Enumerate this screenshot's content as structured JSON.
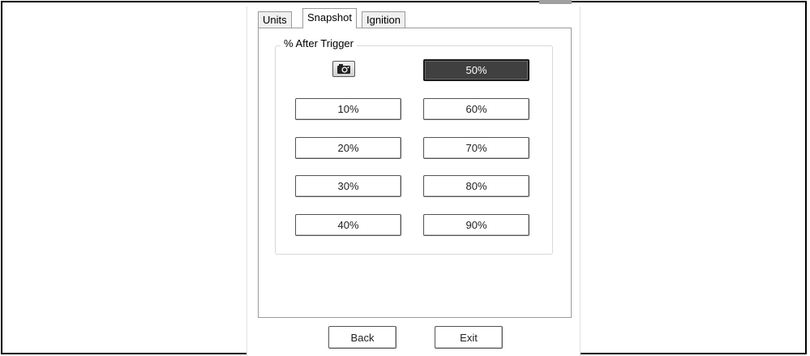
{
  "tabs": [
    {
      "label": "Units"
    },
    {
      "label": "Snapshot",
      "active": true
    },
    {
      "label": "Ignition"
    }
  ],
  "group": {
    "label": "% After Trigger",
    "camera_icon": "camera-icon"
  },
  "buttons": {
    "p10": "10%",
    "p20": "20%",
    "p30": "30%",
    "p40": "40%",
    "p50": "50%",
    "p60": "60%",
    "p70": "70%",
    "p80": "80%",
    "p90": "90%",
    "selected": "50%"
  },
  "footer": {
    "back_label": "Back",
    "exit_label": "Exit"
  }
}
